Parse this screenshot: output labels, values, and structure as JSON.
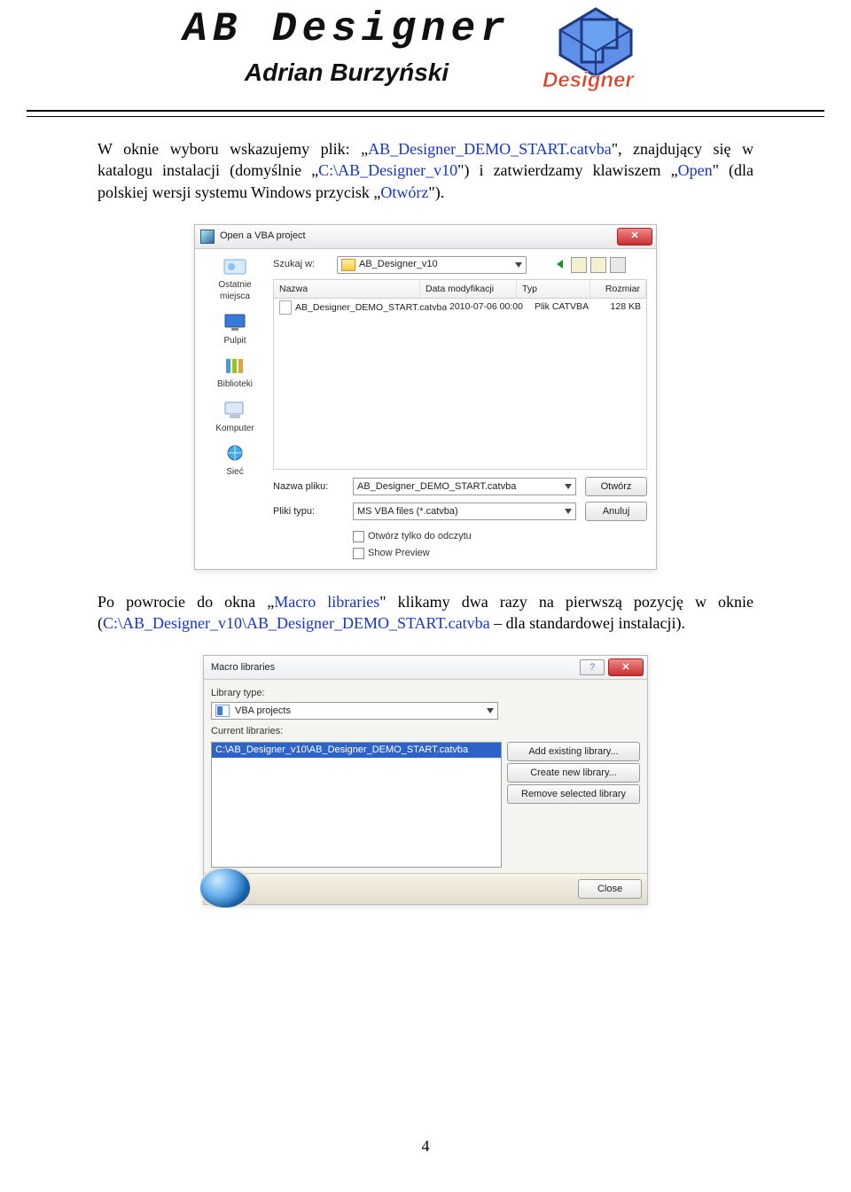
{
  "header": {
    "title_main": "AB Designer",
    "title_sub": "Adrian Burzyński",
    "logo_word": "Designer"
  },
  "para1": {
    "t1": "W oknie wyboru wskazujemy plik: „",
    "file": "AB_Designer_DEMO_START.catvba",
    "t2": "\", znajdujący się w katalogu instalacji (domyślnie „",
    "dir": "C:\\AB_Designer_v10",
    "t3": "\") i zatwierdzamy klawiszem „",
    "open": "Open",
    "t4": "\" (dla polskiej wersji systemu Windows przycisk „",
    "otworz": "Otwórz",
    "t5": "\")."
  },
  "dialog1": {
    "title": "Open a VBA project",
    "lookin_label": "Szukaj w:",
    "lookin_value": "AB_Designer_v10",
    "sidebar": [
      "Ostatnie miejsca",
      "Pulpit",
      "Biblioteki",
      "Komputer",
      "Sieć"
    ],
    "cols": {
      "name": "Nazwa",
      "date": "Data modyfikacji",
      "type": "Typ",
      "size": "Rozmiar"
    },
    "row": {
      "name": "AB_Designer_DEMO_START.catvba",
      "date": "2010-07-06 00:00",
      "type": "Plik CATVBA",
      "size": "128 KB"
    },
    "filename_label": "Nazwa pliku:",
    "filename_value": "AB_Designer_DEMO_START.catvba",
    "filetype_label": "Pliki typu:",
    "filetype_value": "MS VBA files (*.catvba)",
    "open_btn": "Otwórz",
    "cancel_btn": "Anuluj",
    "chk_readonly": "Otwórz tylko do odczytu",
    "chk_preview": "Show Preview"
  },
  "para2": {
    "t1": "Po powrocie do okna „",
    "ml": "Macro libraries",
    "t2": "\" klikamy dwa razy na pierwszą pozycję w oknie (",
    "path": "C:\\AB_Designer_v10\\AB_Designer_DEMO_START.catvba",
    "t3": " – dla standardowej instalacji)."
  },
  "dialog2": {
    "title": "Macro libraries",
    "libtype_label": "Library type:",
    "libtype_value": "VBA projects",
    "current_label": "Current libraries:",
    "selected": "C:\\AB_Designer_v10\\AB_Designer_DEMO_START.catvba",
    "btn_add": "Add existing library...",
    "btn_create": "Create new library...",
    "btn_remove": "Remove selected library",
    "close": "Close"
  },
  "page_number": "4"
}
